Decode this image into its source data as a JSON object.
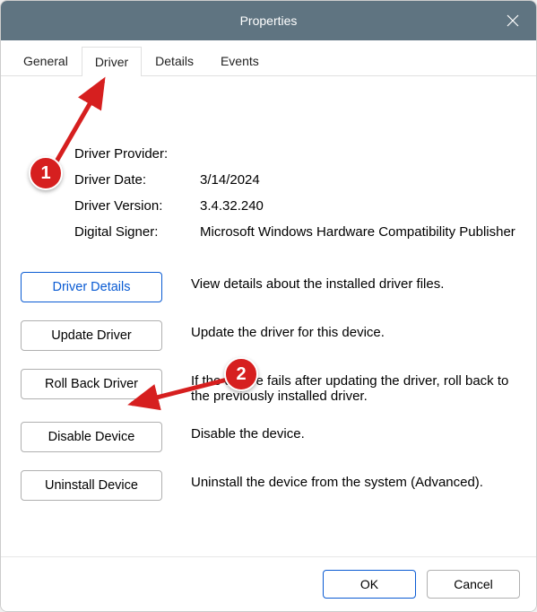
{
  "window": {
    "title": "Properties"
  },
  "tabs": [
    {
      "label": "General",
      "active": false
    },
    {
      "label": "Driver",
      "active": true
    },
    {
      "label": "Details",
      "active": false
    },
    {
      "label": "Events",
      "active": false
    }
  ],
  "info": {
    "provider_lbl": "Driver Provider:",
    "provider_val": "",
    "date_lbl": "Driver Date:",
    "date_val": "3/14/2024",
    "version_lbl": "Driver Version:",
    "version_val": "3.4.32.240",
    "signer_lbl": "Digital Signer:",
    "signer_val": "Microsoft Windows Hardware Compatibility Publisher"
  },
  "actions": {
    "details": {
      "btn": "Driver Details",
      "desc": "View details about the installed driver files."
    },
    "update": {
      "btn": "Update Driver",
      "desc": "Update the driver for this device."
    },
    "rollback": {
      "btn": "Roll Back Driver",
      "desc": "If the device fails after updating the driver, roll back to the previously installed driver."
    },
    "disable": {
      "btn": "Disable Device",
      "desc": "Disable the device."
    },
    "uninstall": {
      "btn": "Uninstall Device",
      "desc": "Uninstall the device from the system (Advanced)."
    }
  },
  "footer": {
    "ok": "OK",
    "cancel": "Cancel"
  },
  "annotations": {
    "badge1": "1",
    "badge2": "2"
  }
}
